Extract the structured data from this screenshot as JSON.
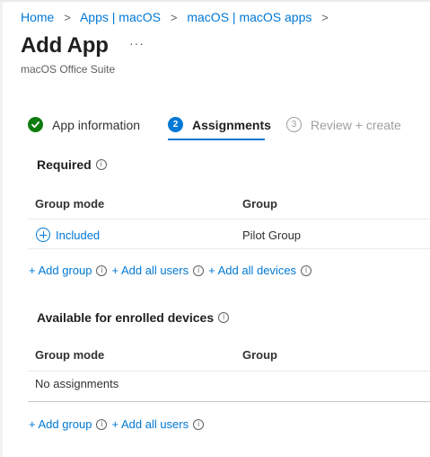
{
  "breadcrumb": {
    "items": [
      "Home",
      "Apps | macOS",
      "macOS | macOS apps"
    ],
    "separator": ">"
  },
  "page": {
    "title": "Add App",
    "more_label": "···",
    "subtitle": "macOS Office Suite"
  },
  "wizard": {
    "steps": [
      {
        "label": "App information",
        "state": "completed",
        "badge": ""
      },
      {
        "label": "Assignments",
        "state": "current",
        "badge": "2"
      },
      {
        "label": "Review + create",
        "state": "future",
        "badge": "3"
      }
    ]
  },
  "required": {
    "title": "Required",
    "columns": [
      "Group mode",
      "Group"
    ],
    "rows": [
      {
        "mode": "Included",
        "group": "Pilot Group"
      }
    ],
    "actions": {
      "add_group": "+ Add group",
      "add_all_users": "+ Add all users",
      "add_all_devices": "+ Add all devices"
    }
  },
  "available": {
    "title": "Available for enrolled devices",
    "columns": [
      "Group mode",
      "Group"
    ],
    "empty_text": "No assignments",
    "actions": {
      "add_group": "+ Add group",
      "add_all_users": "+ Add all users"
    }
  },
  "icons": {
    "info": "info-icon",
    "completed": "checkmark-icon",
    "included": "plus-circle-icon",
    "chevron": "chevron-right-icon"
  },
  "colors": {
    "accent": "#0078d4",
    "success": "#107c10",
    "text": "#323130",
    "muted": "#a19f9d"
  }
}
